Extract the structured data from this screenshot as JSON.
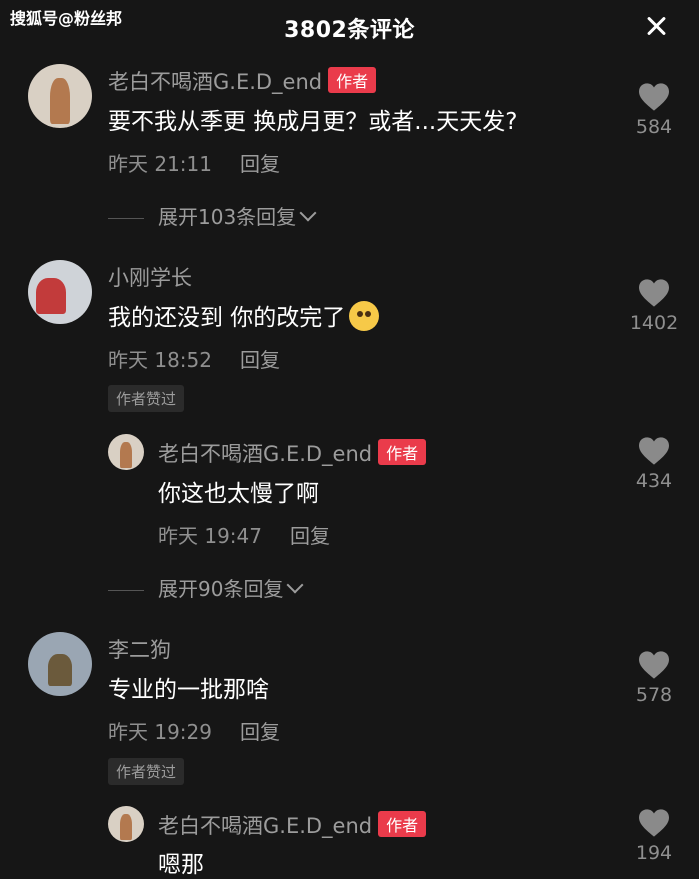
{
  "header": {
    "watermark": "搜狐号@粉丝邦",
    "title": "3802条评论"
  },
  "labels": {
    "author_tag": "作者",
    "reply": "回复",
    "author_liked": "作者赞过"
  },
  "comments": [
    {
      "user": "老白不喝酒G.E.D_end",
      "is_author": true,
      "text": "要不我从季更 换成月更？或者...天天发?",
      "time": "昨天 21:11",
      "likes": "584",
      "expand": "展开103条回复"
    },
    {
      "user": "小刚学长",
      "is_author": false,
      "text": "我的还没到 你的改完了",
      "emoji": "pleading-face-emoji",
      "time": "昨天 18:52",
      "likes": "1402"
    },
    {
      "user": "老白不喝酒G.E.D_end",
      "is_author": true,
      "text": "你这也太慢了啊",
      "time": "昨天 19:47",
      "likes": "434",
      "expand": "展开90条回复"
    },
    {
      "user": "李二狗",
      "is_author": false,
      "text": "专业的一批那啥",
      "time": "昨天 19:29",
      "likes": "578"
    },
    {
      "user": "老白不喝酒G.E.D_end",
      "is_author": true,
      "text": "嗯那",
      "likes": "194"
    }
  ],
  "icons": {
    "close": "close-icon",
    "like": "heart-icon",
    "expand": "chevron-down-icon"
  },
  "colors": {
    "background": "#161616",
    "author_tag": "#ea3b4b"
  }
}
